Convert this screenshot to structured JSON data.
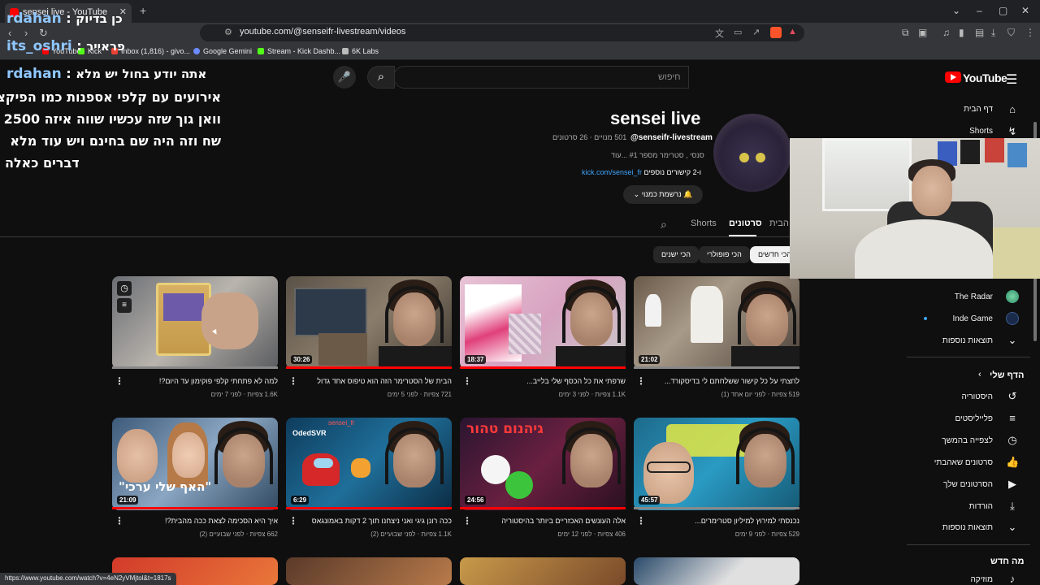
{
  "browser": {
    "tab_title": "sensei live - YouTube",
    "url": "youtube.com/@senseifr-livestream/videos",
    "status_url": "https://www.youtube.com/watch?v=4eN2yVMjtol&t=1817s",
    "bookmarks": [
      "YouTube",
      "Kick",
      "Inbox (1,816) - givo...",
      "Google Gemini",
      "Stream - Kick Dashb...",
      "6K Labs"
    ]
  },
  "youtube": {
    "logo_text": "YouTube",
    "search_placeholder": "חיפוש"
  },
  "channel": {
    "name": "sensei live",
    "handle": "@senseifr-livestream",
    "meta": "501 מנויים ‧ 26 סרטונים",
    "description": "סנסי , סטרימר מספר #1 ...עוד",
    "link_text": "kick.com/sensei_fr",
    "link_suffix": "ו-2 קישורים נוספים",
    "subscribe_label": "נרשמת כמנוי",
    "tabs": [
      "הבית",
      "סרטונים",
      "Shorts"
    ],
    "chips": [
      "הכי חדשים",
      "הכי פופולרי",
      "הכי ישנים"
    ]
  },
  "videos": [
    {
      "title": "לחצתי על כל קישור ששלחתם לי בדיסקורד...",
      "meta": "519 צפיות ‧ לפני יום אחד (1)",
      "duration": "21:02"
    },
    {
      "title": "שרפתי את כל הכסף שלי בלייב...",
      "meta": "1.1K צפיות ‧ לפני 3 ימים",
      "duration": "18:37"
    },
    {
      "title": "הבית של הסטרימר הזה הוא טיפוס אחד גדול",
      "meta": "721 צפיות ‧ לפני 5 ימים",
      "duration": "30:26"
    },
    {
      "title": "למה לא פתחתי קלפי פוקימון עד היום?!",
      "meta": "1.6K צפיות ‧ לפני 7 ימים",
      "duration": ""
    },
    {
      "title": "נכנסתי למירוץ למיליון סטרימרים...",
      "meta": "529 צפיות ‧ לפני 9 ימים",
      "duration": "45:57"
    },
    {
      "title": "אלה העונשים האכזריים ביותר בהיסטוריה",
      "meta": "406 צפיות ‧ לפני 12 ימים",
      "duration": "24:56"
    },
    {
      "title": "ככה רונן גיגי ואני ניצחנו תוך 2 דקות באמונגאס",
      "meta": "1.1K צפיות ‧ לפני שבועיים (2)",
      "duration": "6:29"
    },
    {
      "title": "איך היא הסכימה לצאת ככה מהבית?!",
      "meta": "662 צפיות ‧ לפני שבועיים (2)",
      "duration": "21:09"
    }
  ],
  "thumb_text": {
    "t5": "גיהנום טהור",
    "t6_a": "OdedSVR",
    "t6_b": "sensei_fr",
    "t8": "\"האף שלי ערכי\""
  },
  "sidebar": {
    "home": "דף הבית",
    "shorts": "Shorts",
    "channels": [
      "The Radar",
      "Inde Game"
    ],
    "show_more": "תוצאות נוספות",
    "you_title": "הדף שלי",
    "you_items": [
      "היסטוריה",
      "פלייליסטים",
      "לצפייה בהמשך",
      "סרטונים שאהבתי",
      "הסרטונים שלך",
      "הורדות",
      "תוצאות נוספות"
    ],
    "explore_title": "מה חדש",
    "music": "מוזיקה"
  },
  "chat": [
    {
      "name": "rdahan",
      "msg": "כן בדיוק"
    },
    {
      "name": "its_oshri",
      "msg": "פראייר"
    },
    {
      "name": "rdahan",
      "msg": "אתה יודע בחול יש מלא"
    }
  ],
  "chat_continuation": [
    "אירועים עם קלפי אספנות כמו הפיקצו",
    "וואן גוך שזה עכשיו שווה איזה 2500",
    "שח וזה היה שם בחינם ויש עוד מלא",
    "דברים כאלה"
  ],
  "colors": {
    "accent_red": "#ff0000",
    "link_blue": "#3ea6ff",
    "background": "#0f0f0f"
  }
}
